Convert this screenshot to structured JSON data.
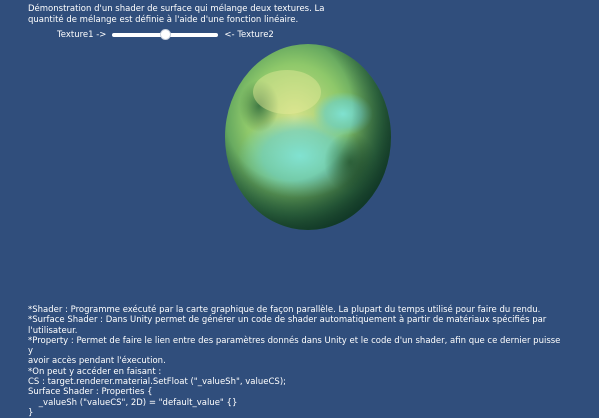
{
  "intro_lines": [
    "Démonstration d'un shader de surface qui mélange deux textures. La",
    "quantité de mélange est définie à l'aide d'une fonction linéaire."
  ],
  "slider": {
    "left_label": "Texture1 ->",
    "right_label": "<- Texture2",
    "value": 0.5
  },
  "sphere": {
    "colors": [
      "#1f5a3e",
      "#3f8a55",
      "#8ec86a",
      "#d6e28a",
      "#6ed0c4"
    ]
  },
  "notes": [
    "*Shader : Programme exécuté par la carte graphique de façon parallèle. La plupart du temps utilisé pour faire du rendu.",
    "*Surface Shader : Dans Unity permet de générer un code de shader automatiquement à partir de matériaux spécifiés par",
    "l'utilisateur.",
    "*Property : Permet de faire le lien entre des paramètres donnés dans Unity et le code d'un shader, afin que ce dernier puisse y",
    "avoir accès pendant l'éxecution.",
    "*On peut y accéder en faisant :",
    "CS : target.renderer.material.SetFloat (\"_valueSh\", valueCS);",
    "Surface Shader : Properties {",
    "    _valueSh (\"valueCS\", 2D) = \"default_value\" {}",
    "}"
  ]
}
